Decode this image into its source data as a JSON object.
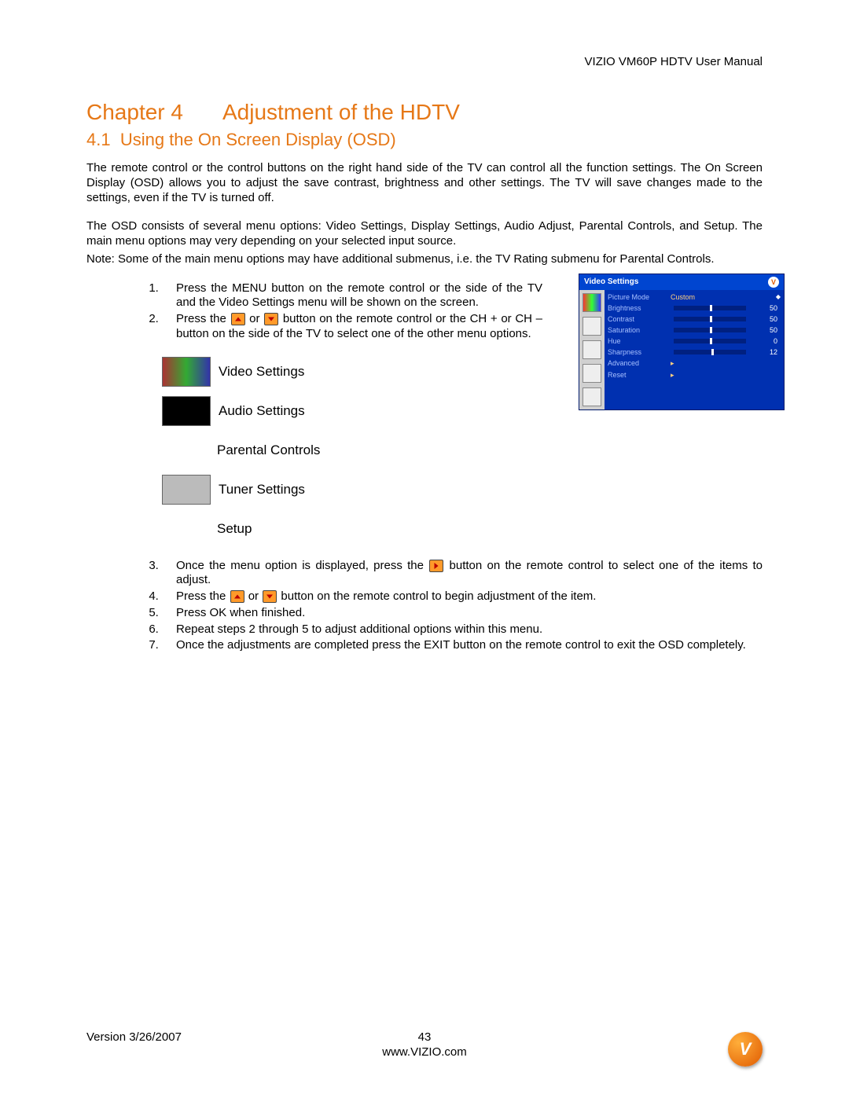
{
  "header": {
    "product": "VIZIO VM60P HDTV User Manual"
  },
  "chapter": {
    "num": "Chapter 4",
    "title": "Adjustment of the HDTV"
  },
  "section": {
    "num": "4.1",
    "title": "Using the On Screen Display (OSD)"
  },
  "paragraphs": {
    "p1": "The remote control or the control buttons on the right hand side of the TV can control all the function settings.  The On Screen Display (OSD) allows you to adjust the save contrast, brightness and other settings.  The TV will save changes made to the settings, even if the TV is turned off.",
    "p2": "The OSD consists of several menu options: Video Settings, Display Settings, Audio Adjust, Parental Controls, and Setup.  The main menu options may very depending on your selected input source.",
    "p3": "Note:  Some of the main menu options may have additional submenus, i.e. the TV Rating submenu for Parental Controls."
  },
  "steps_top": {
    "s1": "Press the MENU button on the remote control or the side of the TV and the Video Settings menu will be shown on the screen.",
    "s2a": "Press the ",
    "s2b": " or ",
    "s2c": " button on the remote control or the CH + or CH – button on the side of the TV to select one of the other menu options."
  },
  "menu_labels": {
    "video": "Video Settings",
    "audio": "Audio Settings",
    "parental": "Parental Controls",
    "tuner": "Tuner Settings",
    "setup": "Setup"
  },
  "steps_bottom": {
    "s3a": "Once the menu option is displayed, press the ",
    "s3b": " button on the remote control to select one of the items to adjust.",
    "s4a": "Press the ",
    "s4b": " or ",
    "s4c": " button on the remote control to begin adjustment of the item.",
    "s5": "Press OK when finished.",
    "s6": "Repeat steps 2 through 5 to adjust additional options within this menu.",
    "s7": "Once the adjustments are completed press the EXIT button on the remote control to exit the OSD completely."
  },
  "osd": {
    "title": "Video Settings",
    "rows": [
      {
        "label": "Picture Mode",
        "value": "Custom",
        "type": "text"
      },
      {
        "label": "Brightness",
        "value": "50",
        "type": "slider",
        "pct": 50
      },
      {
        "label": "Contrast",
        "value": "50",
        "type": "slider",
        "pct": 50
      },
      {
        "label": "Saturation",
        "value": "50",
        "type": "slider",
        "pct": 50
      },
      {
        "label": "Hue",
        "value": "0",
        "type": "slider",
        "pct": 50
      },
      {
        "label": "Sharpness",
        "value": "12",
        "type": "slider",
        "pct": 52
      },
      {
        "label": "Advanced",
        "value": "▸",
        "type": "arrow"
      },
      {
        "label": "Reset",
        "value": "▸",
        "type": "arrow"
      }
    ]
  },
  "footer": {
    "version": "Version 3/26/2007",
    "page": "43",
    "url": "www.VIZIO.com"
  }
}
